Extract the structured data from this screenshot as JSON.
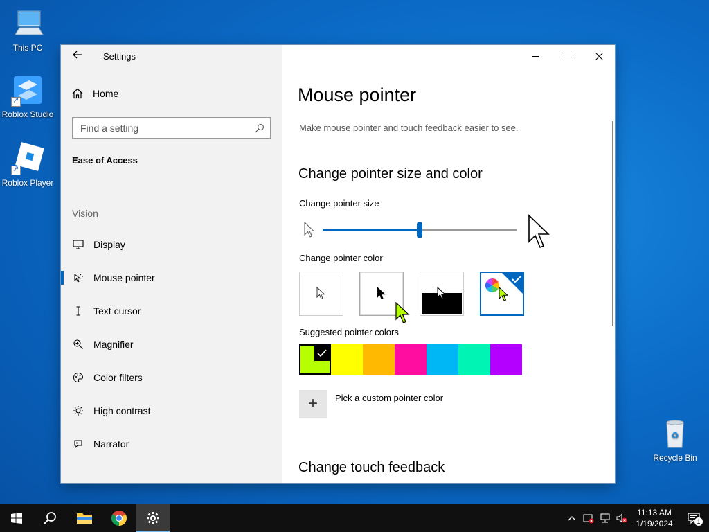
{
  "desktop": {
    "icons": [
      {
        "label": "This PC"
      },
      {
        "label": "Roblox Studio"
      },
      {
        "label": "Roblox Player"
      },
      {
        "label": "Recycle Bin"
      }
    ]
  },
  "window": {
    "app_title": "Settings",
    "controls": {
      "minimize": "minimize",
      "maximize": "maximize",
      "close": "close"
    }
  },
  "sidebar": {
    "home_label": "Home",
    "search_placeholder": "Find a setting",
    "section_label": "Ease of Access",
    "group_label": "Vision",
    "items": [
      {
        "label": "Display",
        "icon": "monitor-icon"
      },
      {
        "label": "Mouse pointer",
        "icon": "mouse-pointer-icon",
        "active": true
      },
      {
        "label": "Text cursor",
        "icon": "text-cursor-icon"
      },
      {
        "label": "Magnifier",
        "icon": "magnifier-icon"
      },
      {
        "label": "Color filters",
        "icon": "palette-icon"
      },
      {
        "label": "High contrast",
        "icon": "brightness-icon"
      },
      {
        "label": "Narrator",
        "icon": "narrator-icon"
      }
    ]
  },
  "main": {
    "title": "Mouse pointer",
    "description": "Make mouse pointer and touch feedback easier to see.",
    "size_color_heading": "Change pointer size and color",
    "size_label": "Change pointer size",
    "size_fraction": 0.5,
    "color_label": "Change pointer color",
    "color_options": [
      "white",
      "black",
      "inverted",
      "custom"
    ],
    "selected_color_option": "custom",
    "suggested_label": "Suggested pointer colors",
    "suggested_colors": [
      "#b6ff00",
      "#ffff00",
      "#ffb900",
      "#ff0da0",
      "#00b7f6",
      "#00f5b4",
      "#b400ff"
    ],
    "selected_suggested_index": 0,
    "custom_color_label": "Pick a custom pointer color",
    "touch_heading": "Change touch feedback"
  },
  "taskbar": {
    "time": "11:13 AM",
    "date": "1/19/2024",
    "notification_count": "1"
  },
  "colors": {
    "accent": "#0067c0",
    "sidebar_bg": "#f2f2f2",
    "taskbar_bg": "#101010"
  }
}
